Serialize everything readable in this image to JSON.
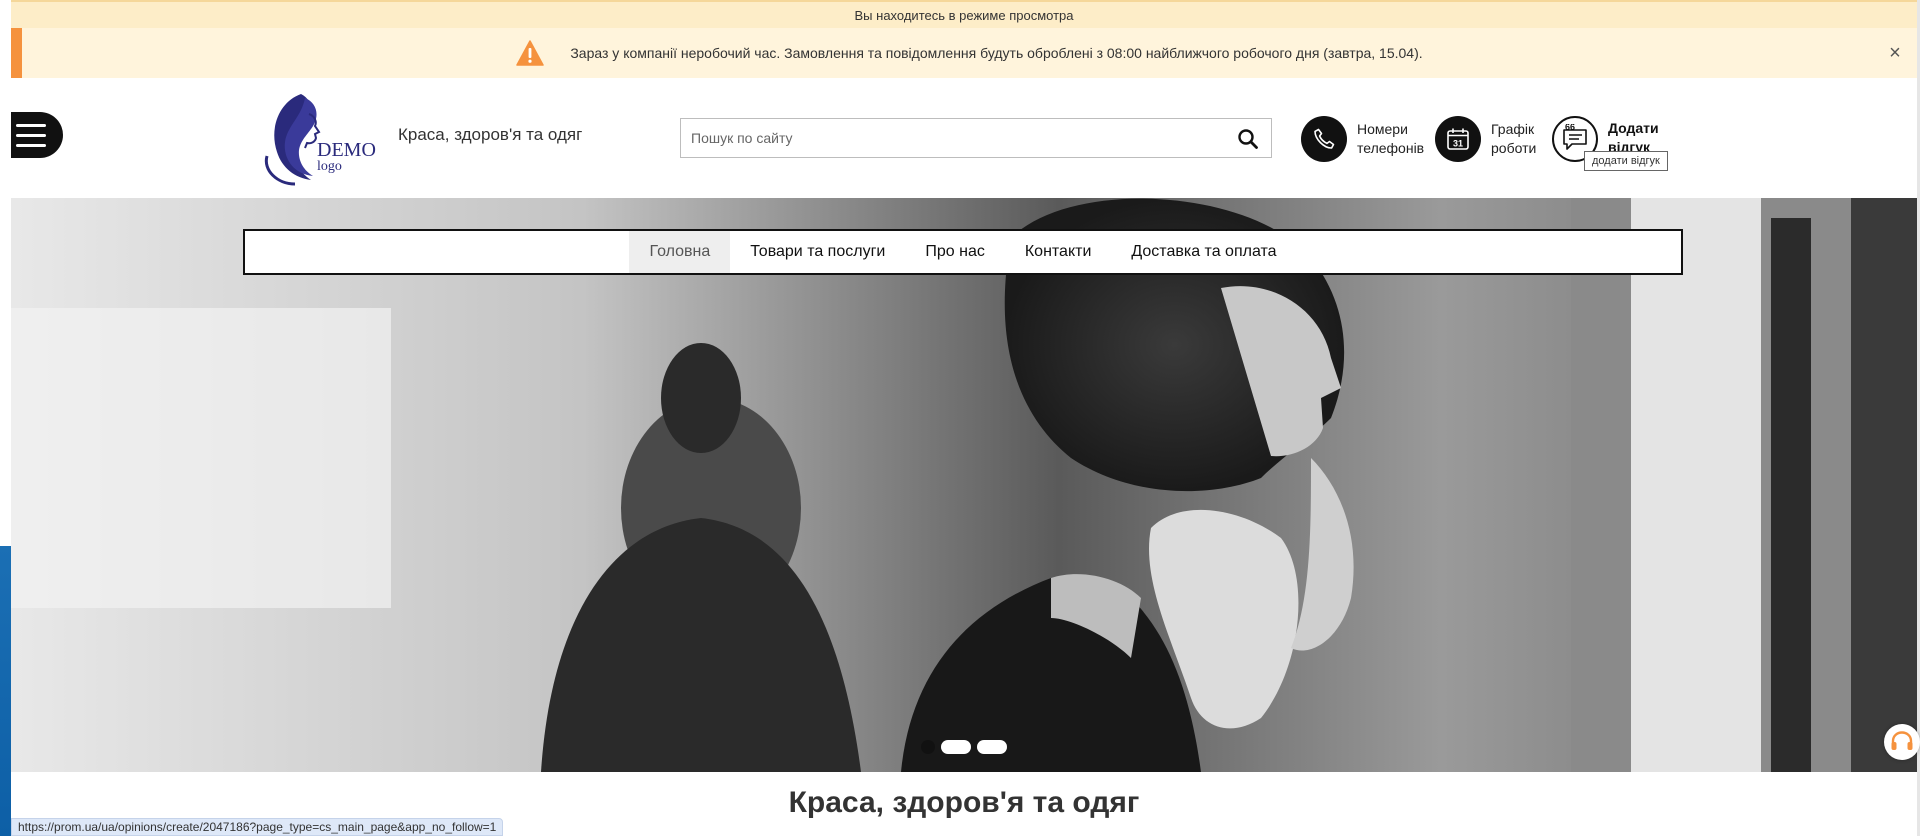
{
  "preview_bar": {
    "text": "Вы находитесь в режиме просмотра"
  },
  "notice": {
    "text": "Зараз у компанії неробочий час. Замовлення та повідомлення будуть оброблені з 08:00 найближчого робочого дня (завтра, 15.04).",
    "close_icon": "×"
  },
  "header": {
    "logo": {
      "main": "DEMO",
      "sub": "logo"
    },
    "tagline": "Краса, здоров'я та одяг",
    "search": {
      "placeholder": "Пошук по сайту",
      "value": ""
    },
    "phones": {
      "line1": "Номери",
      "line2": "телефонів"
    },
    "schedule": {
      "line1": "Графік",
      "line2": "роботи",
      "icon_day": "31"
    },
    "review": {
      "line1": "Додати",
      "line2": "відгук",
      "tooltip": "додати відгук"
    }
  },
  "menu": {
    "items": [
      {
        "label": "Головна",
        "active": true
      },
      {
        "label": "Товари та послуги",
        "active": false
      },
      {
        "label": "Про нас",
        "active": false
      },
      {
        "label": "Контакти",
        "active": false
      },
      {
        "label": "Доставка та оплата",
        "active": false
      }
    ]
  },
  "slider": {
    "count": 3,
    "active_index": 0
  },
  "page_title": "Краса, здоров'я та одяг",
  "status_bar": {
    "url": "https://prom.ua/ua/opinions/create/2047186?page_type=cs_main_page&app_no_follow=1"
  },
  "colors": {
    "accent_orange": "#f5923e",
    "notice_bg": "#fff4dc",
    "preview_bg": "#fdedc8",
    "logo_blue": "#2a2a7c",
    "dark": "#111111"
  }
}
